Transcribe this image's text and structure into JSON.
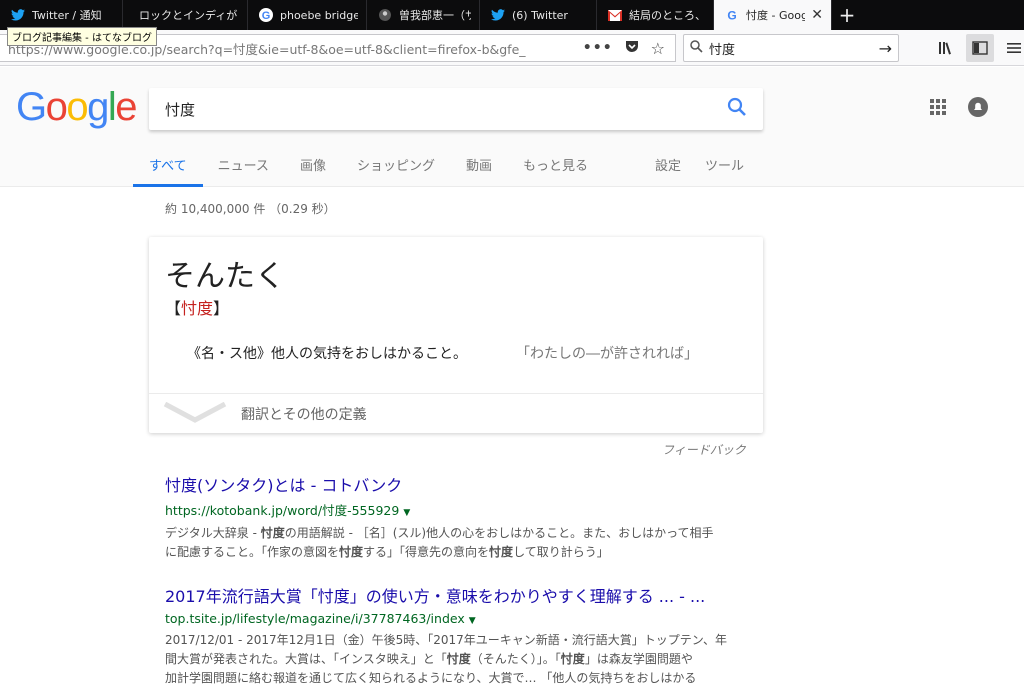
{
  "tabs": [
    {
      "title": "Twitter / 通知",
      "icon": "twitter-bird-icon",
      "active": false
    },
    {
      "title": "ロックとインディが",
      "icon": "none",
      "active": false
    },
    {
      "title": "phoebe bridge",
      "icon": "google-g-icon",
      "active": false
    },
    {
      "title": "曽我部恵一（サ",
      "icon": "avatar-icon",
      "active": false
    },
    {
      "title": "(6) Twitter",
      "icon": "twitter-bird-icon",
      "active": false
    },
    {
      "title": "結局のところ、",
      "icon": "gmail-icon",
      "active": false
    },
    {
      "title": "忖度 - Goog",
      "icon": "google-g-icon",
      "active": true
    }
  ],
  "tooltip": "ブログ記事編集 - はてなブログ",
  "url": "https://www.google.co.jp/search?q=忖度&ie=utf-8&oe=utf-8&client=firefox-b&gfe_",
  "search_box_query": "忖度",
  "google": {
    "logo": "Google",
    "query": "忖度",
    "tabs": [
      "すべて",
      "ニュース",
      "画像",
      "ショッピング",
      "動画",
      "もっと見る"
    ],
    "tabs_right": [
      "設定",
      "ツール"
    ],
    "stats": "約 10,400,000 件 （0.29 秒）"
  },
  "dictionary": {
    "word": "そんたく",
    "kanji_open": "【",
    "kanji": "忖度",
    "kanji_close": "】",
    "definition": "《名・ス他》他人の気持をおしはかること。",
    "example": "「わたしの―が許されれば」",
    "more": "翻訳とその他の定義",
    "feedback": "フィードバック"
  },
  "results": [
    {
      "title": "忖度(ソンタク)とは - コトバンク",
      "cite": "https://kotobank.jp/word/忖度-555929",
      "snippet_lines": [
        [
          "デジタル大辞泉 - ",
          "忖度",
          "の用語解説 - ［名］(スル)他人の心をおしはかること。また、おしはかって相手"
        ],
        [
          "に配慮すること。「作家の意図を",
          "忖度",
          "する」「得意先の意向を",
          "忖度",
          "して取り計らう」"
        ]
      ]
    },
    {
      "title": "2017年流行語大賞「忖度」の使い方・意味をわかりやすく理解する ... - ...",
      "cite": "top.tsite.jp/lifestyle/magazine/i/37787463/index",
      "snippet_lines": [
        [
          "2017/12/01 - 2017年12月1日（金）午後5時、「2017年ユーキャン新語・流行語大賞」トップテン、年"
        ],
        [
          "間大賞が発表された。大賞は、「インスタ映え」と「",
          "忖度",
          "（そんたく）」。「",
          "忖度",
          "」は森友学園問題や"
        ],
        [
          "加計学園問題に絡む報道を通じて広く知られるようになり、大賞で… 「他人の気持ちをおしはかる"
        ]
      ]
    }
  ],
  "colors": {
    "google_blue": "#4285F4",
    "google_red": "#EA4335",
    "google_yellow": "#FBBC05",
    "google_green": "#34A853",
    "link": "#1a0dab",
    "cite": "#006621",
    "accent": "#1a73e8"
  }
}
